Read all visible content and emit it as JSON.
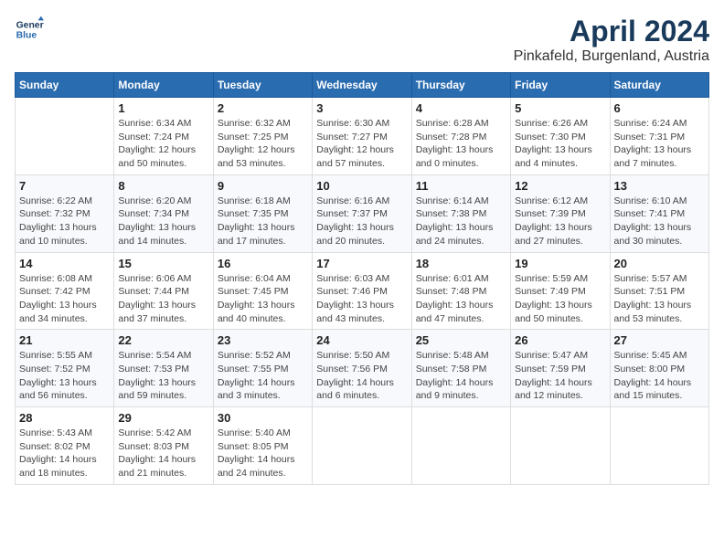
{
  "header": {
    "logo_line1": "General",
    "logo_line2": "Blue",
    "month": "April 2024",
    "location": "Pinkafeld, Burgenland, Austria"
  },
  "weekdays": [
    "Sunday",
    "Monday",
    "Tuesday",
    "Wednesday",
    "Thursday",
    "Friday",
    "Saturday"
  ],
  "weeks": [
    [
      {
        "day": "",
        "info": ""
      },
      {
        "day": "1",
        "info": "Sunrise: 6:34 AM\nSunset: 7:24 PM\nDaylight: 12 hours\nand 50 minutes."
      },
      {
        "day": "2",
        "info": "Sunrise: 6:32 AM\nSunset: 7:25 PM\nDaylight: 12 hours\nand 53 minutes."
      },
      {
        "day": "3",
        "info": "Sunrise: 6:30 AM\nSunset: 7:27 PM\nDaylight: 12 hours\nand 57 minutes."
      },
      {
        "day": "4",
        "info": "Sunrise: 6:28 AM\nSunset: 7:28 PM\nDaylight: 13 hours\nand 0 minutes."
      },
      {
        "day": "5",
        "info": "Sunrise: 6:26 AM\nSunset: 7:30 PM\nDaylight: 13 hours\nand 4 minutes."
      },
      {
        "day": "6",
        "info": "Sunrise: 6:24 AM\nSunset: 7:31 PM\nDaylight: 13 hours\nand 7 minutes."
      }
    ],
    [
      {
        "day": "7",
        "info": "Sunrise: 6:22 AM\nSunset: 7:32 PM\nDaylight: 13 hours\nand 10 minutes."
      },
      {
        "day": "8",
        "info": "Sunrise: 6:20 AM\nSunset: 7:34 PM\nDaylight: 13 hours\nand 14 minutes."
      },
      {
        "day": "9",
        "info": "Sunrise: 6:18 AM\nSunset: 7:35 PM\nDaylight: 13 hours\nand 17 minutes."
      },
      {
        "day": "10",
        "info": "Sunrise: 6:16 AM\nSunset: 7:37 PM\nDaylight: 13 hours\nand 20 minutes."
      },
      {
        "day": "11",
        "info": "Sunrise: 6:14 AM\nSunset: 7:38 PM\nDaylight: 13 hours\nand 24 minutes."
      },
      {
        "day": "12",
        "info": "Sunrise: 6:12 AM\nSunset: 7:39 PM\nDaylight: 13 hours\nand 27 minutes."
      },
      {
        "day": "13",
        "info": "Sunrise: 6:10 AM\nSunset: 7:41 PM\nDaylight: 13 hours\nand 30 minutes."
      }
    ],
    [
      {
        "day": "14",
        "info": "Sunrise: 6:08 AM\nSunset: 7:42 PM\nDaylight: 13 hours\nand 34 minutes."
      },
      {
        "day": "15",
        "info": "Sunrise: 6:06 AM\nSunset: 7:44 PM\nDaylight: 13 hours\nand 37 minutes."
      },
      {
        "day": "16",
        "info": "Sunrise: 6:04 AM\nSunset: 7:45 PM\nDaylight: 13 hours\nand 40 minutes."
      },
      {
        "day": "17",
        "info": "Sunrise: 6:03 AM\nSunset: 7:46 PM\nDaylight: 13 hours\nand 43 minutes."
      },
      {
        "day": "18",
        "info": "Sunrise: 6:01 AM\nSunset: 7:48 PM\nDaylight: 13 hours\nand 47 minutes."
      },
      {
        "day": "19",
        "info": "Sunrise: 5:59 AM\nSunset: 7:49 PM\nDaylight: 13 hours\nand 50 minutes."
      },
      {
        "day": "20",
        "info": "Sunrise: 5:57 AM\nSunset: 7:51 PM\nDaylight: 13 hours\nand 53 minutes."
      }
    ],
    [
      {
        "day": "21",
        "info": "Sunrise: 5:55 AM\nSunset: 7:52 PM\nDaylight: 13 hours\nand 56 minutes."
      },
      {
        "day": "22",
        "info": "Sunrise: 5:54 AM\nSunset: 7:53 PM\nDaylight: 13 hours\nand 59 minutes."
      },
      {
        "day": "23",
        "info": "Sunrise: 5:52 AM\nSunset: 7:55 PM\nDaylight: 14 hours\nand 3 minutes."
      },
      {
        "day": "24",
        "info": "Sunrise: 5:50 AM\nSunset: 7:56 PM\nDaylight: 14 hours\nand 6 minutes."
      },
      {
        "day": "25",
        "info": "Sunrise: 5:48 AM\nSunset: 7:58 PM\nDaylight: 14 hours\nand 9 minutes."
      },
      {
        "day": "26",
        "info": "Sunrise: 5:47 AM\nSunset: 7:59 PM\nDaylight: 14 hours\nand 12 minutes."
      },
      {
        "day": "27",
        "info": "Sunrise: 5:45 AM\nSunset: 8:00 PM\nDaylight: 14 hours\nand 15 minutes."
      }
    ],
    [
      {
        "day": "28",
        "info": "Sunrise: 5:43 AM\nSunset: 8:02 PM\nDaylight: 14 hours\nand 18 minutes."
      },
      {
        "day": "29",
        "info": "Sunrise: 5:42 AM\nSunset: 8:03 PM\nDaylight: 14 hours\nand 21 minutes."
      },
      {
        "day": "30",
        "info": "Sunrise: 5:40 AM\nSunset: 8:05 PM\nDaylight: 14 hours\nand 24 minutes."
      },
      {
        "day": "",
        "info": ""
      },
      {
        "day": "",
        "info": ""
      },
      {
        "day": "",
        "info": ""
      },
      {
        "day": "",
        "info": ""
      }
    ]
  ]
}
